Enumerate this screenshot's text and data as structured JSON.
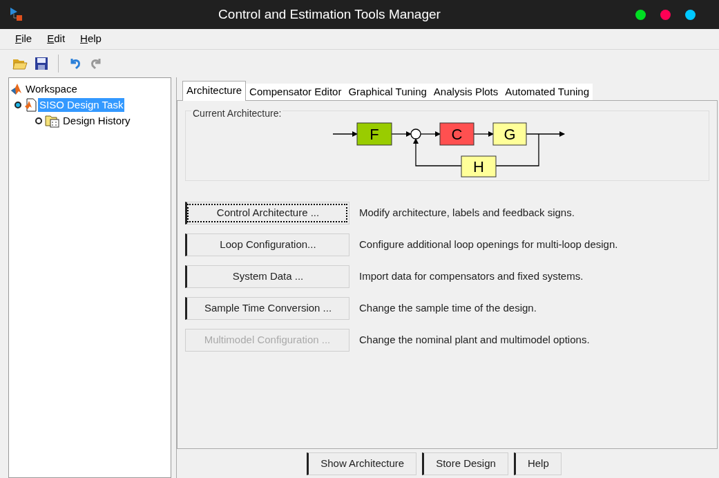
{
  "window": {
    "title": "Control and Estimation Tools Manager",
    "dots": [
      {
        "color": "#00dd22"
      },
      {
        "color": "#ff0055"
      },
      {
        "color": "#00c8ff"
      }
    ]
  },
  "menu": [
    "File",
    "Edit",
    "Help"
  ],
  "tree": [
    {
      "label": "Workspace",
      "kind": "workspace",
      "selected": false,
      "children": [
        {
          "label": "SISO Design Task",
          "kind": "task",
          "selected": true,
          "children": [
            {
              "label": "Design History",
              "kind": "history",
              "selected": false
            }
          ]
        }
      ]
    }
  ],
  "tabs": [
    {
      "label": "Architecture",
      "selected": true
    },
    {
      "label": "Compensator Editor",
      "selected": false
    },
    {
      "label": "Graphical Tuning",
      "selected": false
    },
    {
      "label": "Analysis Plots",
      "selected": false
    },
    {
      "label": "Automated Tuning",
      "selected": false
    }
  ],
  "architecture": {
    "title": "Current Architecture:",
    "blocks": [
      {
        "label": "F",
        "color": "#99cc00"
      },
      {
        "label": "C",
        "color": "#ff5050"
      },
      {
        "label": "G",
        "color": "#ffff99"
      },
      {
        "label": "H",
        "color": "#ffff99"
      }
    ]
  },
  "actions": [
    {
      "button": "Control Architecture ...",
      "description": "Modify architecture, labels and feedback signs.",
      "disabled": false,
      "focused": true
    },
    {
      "button": "Loop Configuration...",
      "description": "Configure additional loop openings for multi-loop design.",
      "disabled": false,
      "focused": false
    },
    {
      "button": "System Data ...",
      "description": "Import data for compensators and fixed systems.",
      "disabled": false,
      "focused": false
    },
    {
      "button": "Sample Time Conversion ...",
      "description": "Change the sample time of the design.",
      "disabled": false,
      "focused": false
    },
    {
      "button": "Multimodel Configuration ...",
      "description": "Change the nominal plant and multimodel options.",
      "disabled": true,
      "focused": false
    }
  ],
  "footer_buttons": [
    "Show Architecture",
    "Store Design",
    "Help"
  ]
}
